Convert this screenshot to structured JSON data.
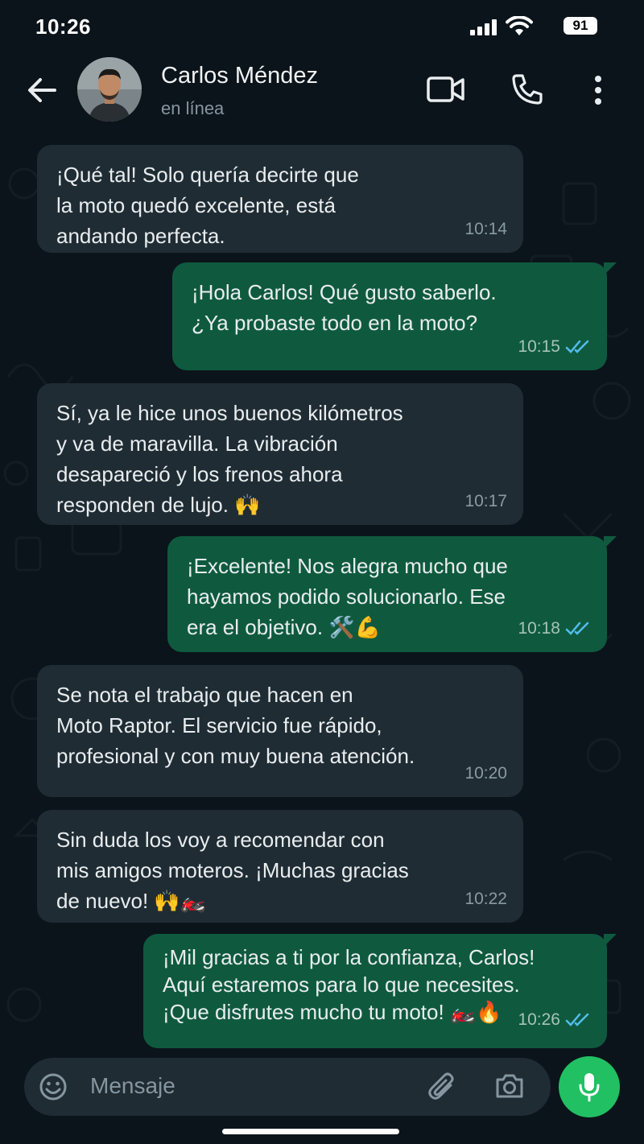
{
  "status_bar": {
    "time": "10:26",
    "battery": "91"
  },
  "header": {
    "contact_name": "Carlos Méndez",
    "contact_status": "en línea"
  },
  "messages": [
    {
      "direction": "in",
      "text": "¡Qué tal! Solo quería decirte que\nla moto quedó excelente, está\nandando perfecta.",
      "time": "10:14"
    },
    {
      "direction": "out",
      "text": "¡Hola Carlos! Qué gusto saberlo.\n¿Ya probaste todo en la moto?",
      "time": "10:15",
      "read": true
    },
    {
      "direction": "in",
      "text": "Sí, ya le hice unos buenos kilómetros\ny va de maravilla. La vibración\ndesapareció y los frenos ahora\nresponden de lujo. 🙌",
      "time": "10:17"
    },
    {
      "direction": "out",
      "text": "¡Excelente! Nos alegra mucho que\nhayamos podido solucionarlo. Ese\nera el objetivo. 🛠️💪",
      "time": "10:18",
      "read": true
    },
    {
      "direction": "in",
      "text": "Se nota el trabajo que hacen en\nMoto Raptor. El servicio fue rápido,\nprofesional y con muy buena atención.",
      "time": "10:20"
    },
    {
      "direction": "in",
      "text": "Sin duda los voy a recomendar con\nmis amigos moteros. ¡Muchas gracias\nde nuevo! 🙌🏍️",
      "time": "10:22"
    },
    {
      "direction": "out",
      "text": "¡Mil gracias a ti por la confianza, Carlos!\nAquí estaremos para lo que necesites.\n¡Que disfrutes mucho tu moto! 🏍️🔥",
      "time": "10:26",
      "read": true
    }
  ],
  "input": {
    "placeholder": "Mensaje"
  },
  "colors": {
    "background": "#0b141a",
    "incoming_bubble": "#1f2c34",
    "outgoing_bubble": "#0f5a3f",
    "read_ticks": "#53bdeb",
    "mic_button": "#21c063"
  },
  "icons": {
    "back": "arrow-left-icon",
    "video": "video-camera-icon",
    "call": "phone-icon",
    "menu": "more-vertical-icon",
    "emoji": "emoji-icon",
    "attach": "paperclip-icon",
    "camera": "camera-icon",
    "mic": "microphone-icon",
    "ticks": "double-check-icon"
  }
}
